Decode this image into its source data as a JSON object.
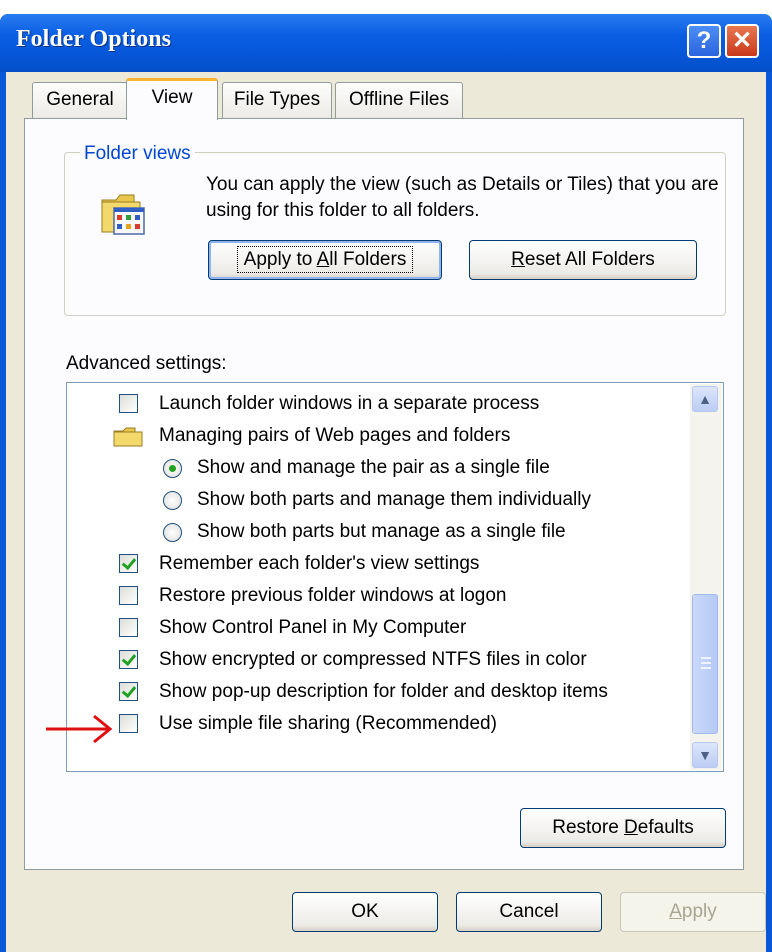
{
  "window": {
    "title": "Folder Options",
    "help": "?",
    "close": "✕"
  },
  "tabs": [
    {
      "label": "General"
    },
    {
      "label": "View",
      "active": true
    },
    {
      "label": "File Types"
    },
    {
      "label": "Offline Files"
    }
  ],
  "folder_views": {
    "group_label": "Folder views",
    "description": "You can apply the view (such as Details or Tiles) that you are using for this folder to all folders.",
    "apply_btn": {
      "pre": "Apply to ",
      "key": "A",
      "post": "ll Folders"
    },
    "reset_btn": {
      "pre": "",
      "key": "R",
      "post": "eset All Folders"
    }
  },
  "advanced": {
    "label": "Advanced settings:",
    "items": [
      {
        "type": "checkbox",
        "checked": false,
        "text": "Launch folder windows in a separate process"
      },
      {
        "type": "folder",
        "text": "Managing pairs of Web pages and folders"
      },
      {
        "type": "radio",
        "checked": true,
        "text": "Show and manage the pair as a single file"
      },
      {
        "type": "radio",
        "checked": false,
        "text": "Show both parts and manage them individually"
      },
      {
        "type": "radio",
        "checked": false,
        "text": "Show both parts but manage as a single file"
      },
      {
        "type": "checkbox",
        "checked": true,
        "text": "Remember each folder's view settings"
      },
      {
        "type": "checkbox",
        "checked": false,
        "text": "Restore previous folder windows at logon"
      },
      {
        "type": "checkbox",
        "checked": false,
        "text": "Show Control Panel in My Computer"
      },
      {
        "type": "checkbox",
        "checked": true,
        "text": "Show encrypted or compressed NTFS files in color"
      },
      {
        "type": "checkbox",
        "checked": true,
        "text": "Show pop-up description for folder and desktop items"
      },
      {
        "type": "checkbox",
        "checked": false,
        "text": "Use simple file sharing (Recommended)"
      }
    ]
  },
  "buttons": {
    "restore": {
      "pre": "Restore ",
      "key": "D",
      "post": "efaults"
    },
    "ok": "OK",
    "cancel": "Cancel",
    "apply": {
      "pre": "",
      "key": "A",
      "post": "pply"
    }
  },
  "colors": {
    "titlebar": "#0b5fe3",
    "dialog_bg": "#ece9d8",
    "group_label": "#0046d5",
    "check_green": "#21a121",
    "annotation_arrow": "#e01010"
  }
}
